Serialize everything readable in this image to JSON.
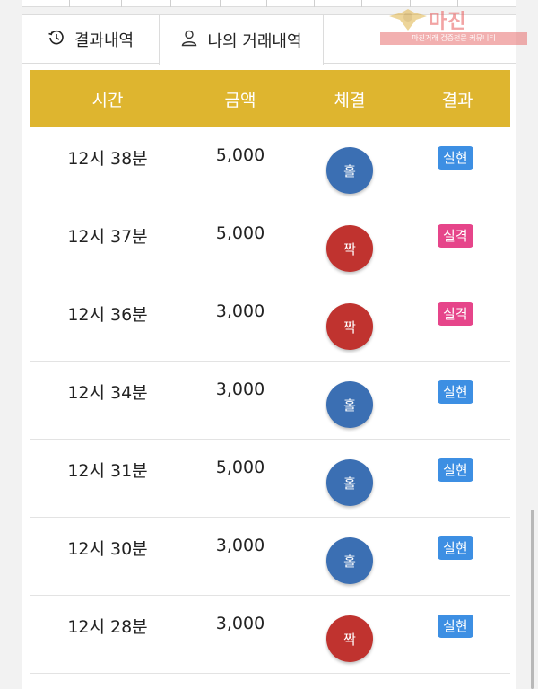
{
  "tabs": [
    {
      "label": "결과내역",
      "icon": "history-icon",
      "active": false
    },
    {
      "label": "나의 거래내역",
      "icon": "user-icon",
      "active": true
    }
  ],
  "table": {
    "headers": [
      "시간",
      "금액",
      "체결",
      "결과"
    ],
    "header_color": "#deb52f",
    "rows": [
      {
        "time": "12시 38분",
        "amount": "5,000",
        "pick": "홀",
        "result": "실현"
      },
      {
        "time": "12시 37분",
        "amount": "5,000",
        "pick": "짝",
        "result": "실격"
      },
      {
        "time": "12시 36분",
        "amount": "3,000",
        "pick": "짝",
        "result": "실격"
      },
      {
        "time": "12시 34분",
        "amount": "3,000",
        "pick": "홀",
        "result": "실현"
      },
      {
        "time": "12시 31분",
        "amount": "5,000",
        "pick": "홀",
        "result": "실현"
      },
      {
        "time": "12시 30분",
        "amount": "3,000",
        "pick": "홀",
        "result": "실현"
      },
      {
        "time": "12시 28분",
        "amount": "3,000",
        "pick": "짝",
        "result": "실현"
      }
    ]
  },
  "colors": {
    "odd_ball": "#3b6fb3",
    "even_ball": "#c0332f",
    "win_badge": "#3d8fe3",
    "lose_badge": "#e6458a"
  },
  "watermark": {
    "title": "마진",
    "subtitle": "마진거래 검증전문 커뮤니티"
  }
}
